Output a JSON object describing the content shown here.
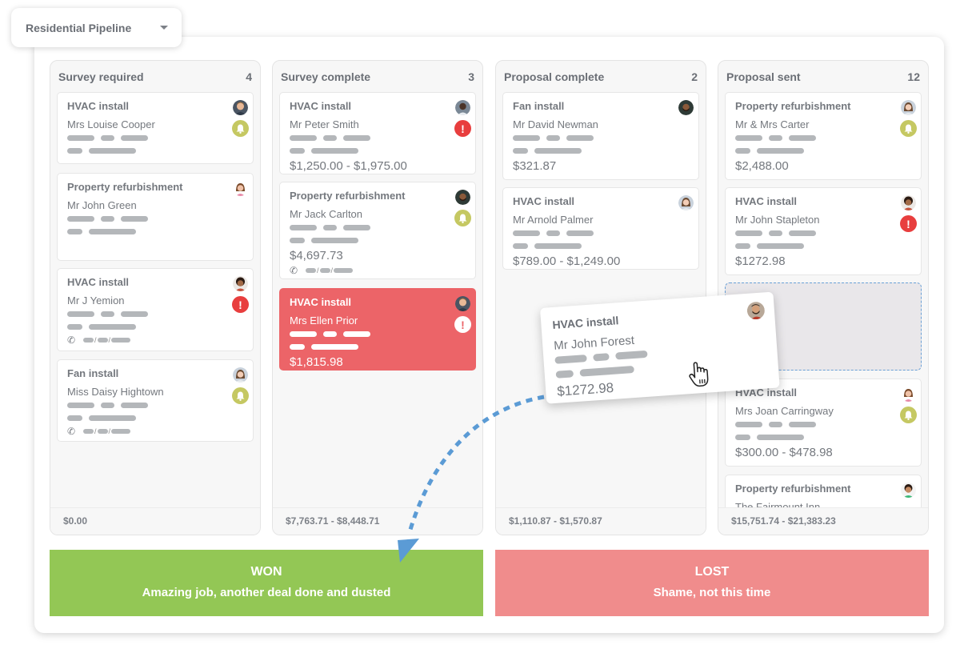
{
  "pipeline_selector": {
    "label": "Residential Pipeline",
    "icon": "caret-down-icon"
  },
  "columns": [
    {
      "title": "Survey required",
      "count": "4",
      "total": "$0.00",
      "cards": [
        {
          "type": "HVAC install",
          "client": "Mrs Louise Cooper",
          "value": "",
          "status": "bell",
          "phone": false
        },
        {
          "type": "Property refurbishment",
          "client": "Mr John Green",
          "value": "",
          "status": "",
          "phone": false
        },
        {
          "type": "HVAC install",
          "client": "Mr J Yemion",
          "value": "",
          "status": "alert",
          "phone": true
        },
        {
          "type": "Fan install",
          "client": "Miss Daisy Hightown",
          "value": "",
          "status": "bell",
          "phone": true
        }
      ]
    },
    {
      "title": "Survey complete",
      "count": "3",
      "total": "$7,763.71 - $8,448.71",
      "cards": [
        {
          "type": "HVAC install",
          "client": "Mr Peter Smith",
          "value": "$1,250.00 - $1,975.00",
          "status": "alert",
          "phone": false
        },
        {
          "type": "Property refurbishment",
          "client": "Mr Jack Carlton",
          "value": "$4,697.73",
          "status": "bell",
          "phone": true
        },
        {
          "type": "HVAC install",
          "client": "Mrs Ellen Prior",
          "value": "$1,815.98",
          "status": "alert",
          "phone": false,
          "highlight": true
        }
      ]
    },
    {
      "title": "Proposal complete",
      "count": "2",
      "total": "$1,110.87 - $1,570.87",
      "cards": [
        {
          "type": "Fan install",
          "client": "Mr David Newman",
          "value": "$321.87",
          "status": "",
          "phone": false
        },
        {
          "type": "HVAC install",
          "client": "Mr Arnold Palmer",
          "value": "$789.00 - $1,249.00",
          "status": "",
          "phone": false
        }
      ]
    },
    {
      "title": "Proposal sent",
      "count": "12",
      "total": "$15,751.74 - $21,383.23",
      "cards": [
        {
          "type": "Property refurbishment",
          "client": "Mr & Mrs Carter",
          "value": "$2,488.00",
          "status": "bell",
          "phone": false
        },
        {
          "type": "HVAC install",
          "client": "Mr John Stapleton",
          "value": "$1272.98",
          "status": "alert",
          "phone": false
        },
        {
          "type": "HVAC install",
          "client": "Mrs Joan Carringway",
          "value": "$300.00 - $478.98",
          "status": "bell",
          "phone": false
        },
        {
          "type": "Property refurbishment",
          "client": "The Fairmount Inn",
          "value": "",
          "status": "",
          "phone": false
        }
      ]
    }
  ],
  "dragged_card": {
    "type": "HVAC install",
    "client": "Mr John Forest",
    "value": "$1272.98"
  },
  "outcomes": {
    "won": {
      "title": "WON",
      "subtitle": "Amazing job, another deal done and dusted",
      "color": "#93c755"
    },
    "lost": {
      "title": "LOST",
      "subtitle": "Shame, not this time",
      "color": "#f08c8c"
    }
  },
  "colors": {
    "alert": "#e83e3e",
    "bell": "#c5c862",
    "highlight_card": "#ec6468",
    "drop_zone_border": "#6aa0d6"
  }
}
